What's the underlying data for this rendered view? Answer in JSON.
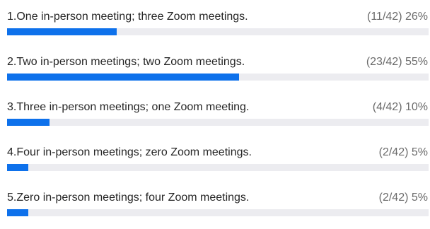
{
  "poll": {
    "accent_color": "#0e71eb",
    "track_color": "#ececf0",
    "options": [
      {
        "label": "1.One in-person meeting; three Zoom meetings.",
        "result": "(11/42) 26%",
        "fraction": 0.26
      },
      {
        "label": "2.Two in-person meetings; two Zoom meetings.",
        "result": "(23/42) 55%",
        "fraction": 0.55
      },
      {
        "label": "3.Three in-person meetings; one Zoom meeting.",
        "result": "(4/42) 10%",
        "fraction": 0.1
      },
      {
        "label": "4.Four in-person meetings; zero Zoom meetings.",
        "result": "(2/42) 5%",
        "fraction": 0.05
      },
      {
        "label": "5.Zero in-person meetings; four Zoom meetings.",
        "result": "(2/42) 5%",
        "fraction": 0.05
      }
    ]
  }
}
